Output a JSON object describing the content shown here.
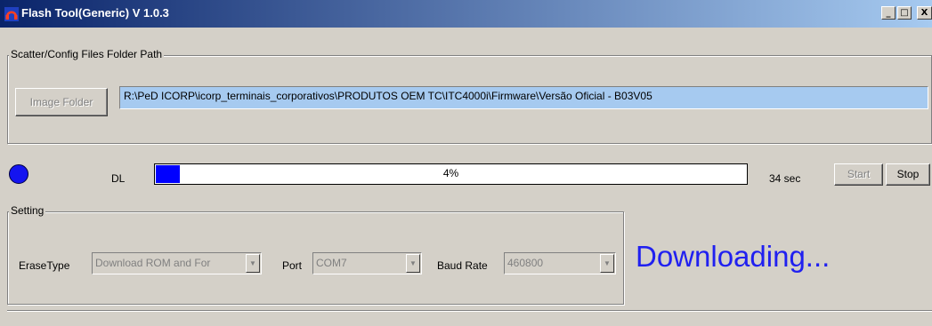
{
  "window": {
    "title": "Flash Tool(Generic) V 1.0.3",
    "controls": {
      "minimize": "_",
      "maximize": "□",
      "close": "X"
    }
  },
  "scatter_group": {
    "label": "Scatter/Config Files Folder Path",
    "image_folder_button": "Image Folder",
    "path_value": "R:\\PeD ICORP\\icorp_terminais_corporativos\\PRODUTOS OEM TC\\ITC4000i\\Firmware\\Versão Oficial - B03V05"
  },
  "download": {
    "label": "DL",
    "progress": 0.04,
    "progress_text": "4%",
    "elapsed": "34 sec",
    "start_button": "Start",
    "stop_button": "Stop",
    "status_dot_color": "#1414f0"
  },
  "setting_group": {
    "label": "Setting",
    "erase_type_label": "EraseType",
    "erase_type_value": "Download ROM and For",
    "port_label": "Port",
    "port_value": "COM7",
    "baud_label": "Baud Rate",
    "baud_value": "460800"
  },
  "status_message": "Downloading..."
}
